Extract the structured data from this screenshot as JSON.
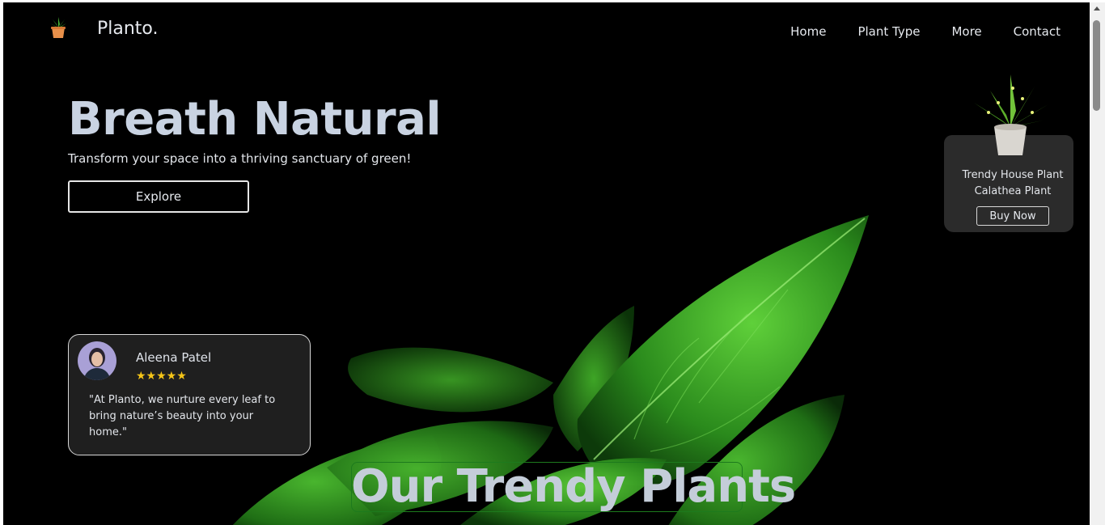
{
  "brand": {
    "name": "Planto."
  },
  "nav": {
    "items": [
      "Home",
      "Plant Type",
      "More",
      "Contact"
    ]
  },
  "hero": {
    "title": "Breath Natural",
    "subtitle": "Transform your space into a thriving sanctuary of green!",
    "cta_label": "Explore"
  },
  "review": {
    "name": "Aleena Patel",
    "stars": "★★★★★",
    "quote": "\"At Planto, we nurture every leaf to bring nature’s beauty into your home.\""
  },
  "product": {
    "line1": "Trendy House Plant",
    "line2": "Calathea Plant",
    "buy_label": "Buy Now"
  },
  "section": {
    "title": "Our Trendy Plants"
  },
  "colors": {
    "background": "#000000",
    "card": "#1f1f1f",
    "leaf": "#2e9a1e",
    "star": "#f5c518",
    "frame": "#1d7a1d"
  },
  "icons": {
    "logo": "potted-plant-icon",
    "avatar": "user-avatar"
  }
}
